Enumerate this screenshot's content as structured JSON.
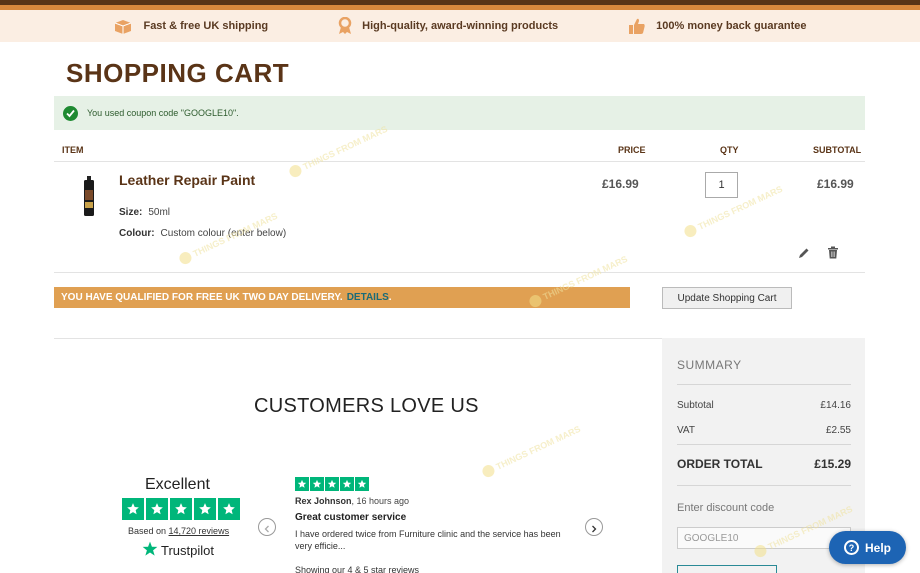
{
  "usp": [
    {
      "icon": "box-icon",
      "text": "Fast & free UK shipping"
    },
    {
      "icon": "award-icon",
      "text": "High-quality, award-winning products"
    },
    {
      "icon": "thumbs-up-icon",
      "text": "100% money back guarantee"
    }
  ],
  "page": {
    "title": "SHOPPING CART"
  },
  "coupon_message": "You used coupon code \"GOOGLE10\".",
  "cart": {
    "headers": {
      "item": "ITEM",
      "price": "PRICE",
      "qty": "QTY",
      "subtotal": "SUBTOTAL"
    },
    "item": {
      "name": "Leather Repair Paint",
      "size_label": "Size:",
      "size_value": "50ml",
      "colour_label": "Colour:",
      "colour_value": "Custom colour (enter below)",
      "price": "£16.99",
      "qty": "1",
      "subtotal": "£16.99"
    },
    "delivery_text": "YOU HAVE QUALIFIED FOR FREE UK TWO DAY DELIVERY.",
    "delivery_link": "DETAILS",
    "delivery_end": ".",
    "update_button": "Update Shopping Cart"
  },
  "customers": {
    "title": "CUSTOMERS LOVE US",
    "rating_word": "Excellent",
    "based_prefix": "Based on ",
    "review_count": "14,720 reviews",
    "trustpilot": "Trustpilot",
    "review": {
      "author": "Rex Johnson",
      "time": ", 16 hours ago",
      "title": "Great customer service",
      "body": "I have ordered twice from Furniture clinic and the service has been very efficie...",
      "showing": "Showing our 4 & 5 star reviews"
    }
  },
  "summary": {
    "title": "SUMMARY",
    "subtotal_label": "Subtotal",
    "subtotal_value": "£14.16",
    "vat_label": "VAT",
    "vat_value": "£2.55",
    "total_label": "ORDER TOTAL",
    "total_value": "£15.29",
    "discount_label": "Enter discount code",
    "discount_value": "GOOGLE10"
  },
  "help": {
    "label": "Help"
  },
  "watermark": "THINGS FROM MARS",
  "colors": {
    "brand_brown": "#5a3417",
    "accent_orange": "#e0a052",
    "trustpilot_green": "#00b67a",
    "help_blue": "#1d64b4"
  }
}
